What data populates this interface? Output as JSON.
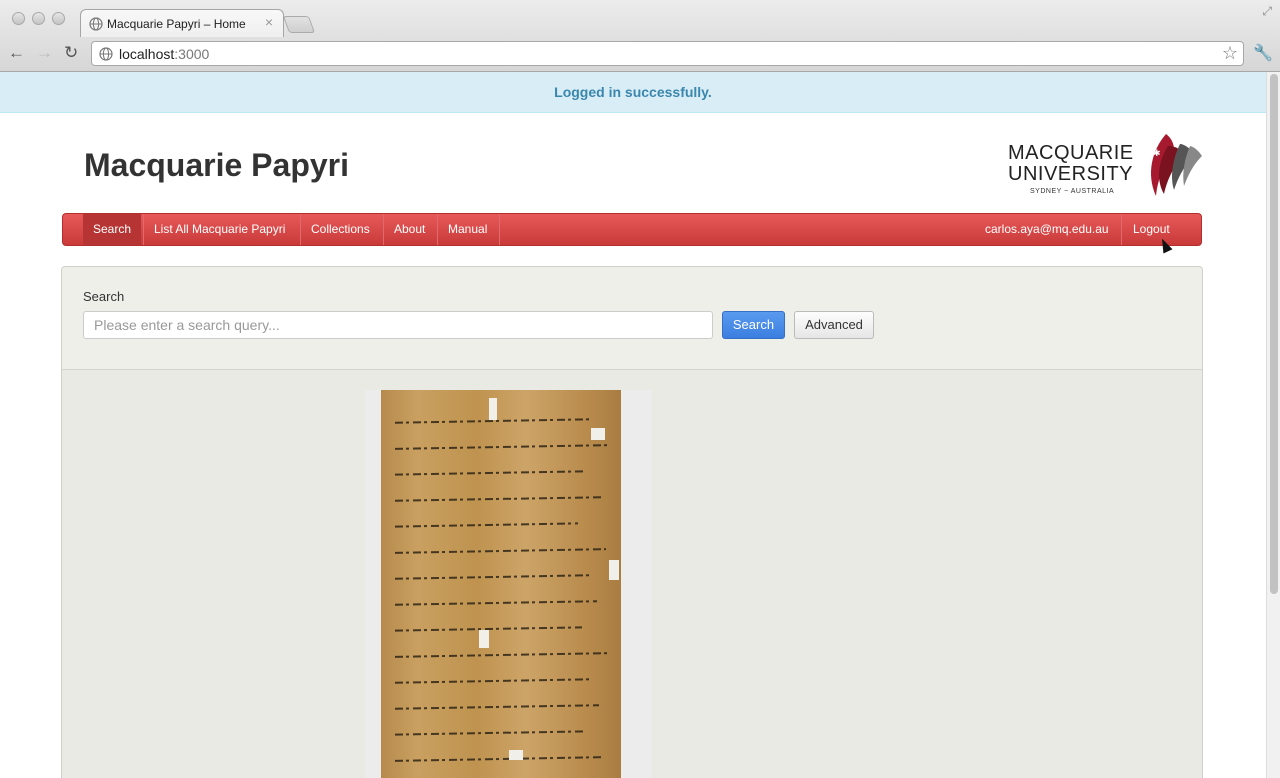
{
  "browser": {
    "tab_title": "Macquarie Papyri – Home",
    "tab_close": "×",
    "url_host": "localhost",
    "url_port": ":3000"
  },
  "flash": {
    "message": "Logged in successfully."
  },
  "site": {
    "title": "Macquarie Papyri"
  },
  "logo": {
    "line1": "MACQUARIE",
    "line2": "UNIVERSITY",
    "line3": "SYDNEY ~ AUSTRALIA"
  },
  "nav": {
    "items": [
      {
        "label": "Search",
        "active": true
      },
      {
        "label": "List All Macquarie Papyri"
      },
      {
        "label": "Collections"
      },
      {
        "label": "About"
      },
      {
        "label": "Manual"
      }
    ],
    "user_email": "carlos.aya@mq.edu.au",
    "logout_label": "Logout"
  },
  "search": {
    "label": "Search",
    "placeholder": "Please enter a search query...",
    "button_label": "Search",
    "advanced_label": "Advanced"
  },
  "colors": {
    "flash_bg": "#d9edf7",
    "flash_text": "#3a87ad",
    "navbar": "#d94a49",
    "search_button": "#4a8ce8"
  }
}
